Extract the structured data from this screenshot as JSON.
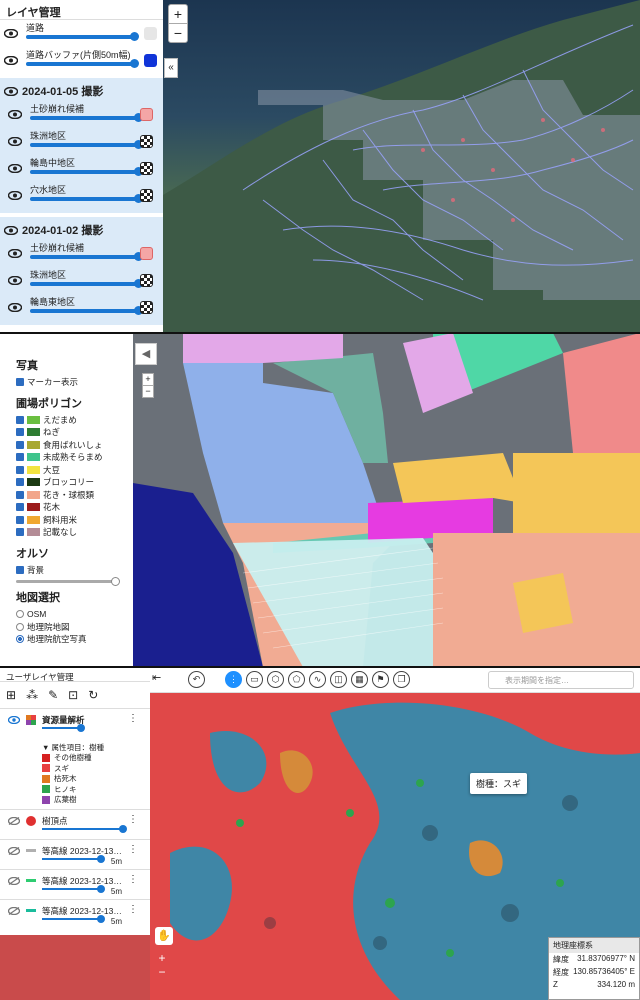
{
  "panel1": {
    "header": "レイヤ管理",
    "top_layers": [
      {
        "label": "道路",
        "swatch": "#e6e6e6"
      },
      {
        "label": "道路バッファ(片側50m幅)",
        "swatch": "#1034d8"
      }
    ],
    "groups": [
      {
        "title": "2024-01-05 撮影",
        "layers": [
          {
            "label": "土砂崩れ候補",
            "swatch": "#f4a6a6"
          },
          {
            "label": "珠洲地区",
            "swatch": "checker"
          },
          {
            "label": "輪島中地区",
            "swatch": "checker"
          },
          {
            "label": "穴水地区",
            "swatch": "checker"
          }
        ]
      },
      {
        "title": "2024-01-02 撮影",
        "layers": [
          {
            "label": "土砂崩れ候補",
            "swatch": "#f4a6a6"
          },
          {
            "label": "珠洲地区",
            "swatch": "checker"
          },
          {
            "label": "輪島東地区",
            "swatch": "checker"
          }
        ]
      }
    ],
    "zoom_in": "+",
    "zoom_out": "−",
    "collapse": "«"
  },
  "panel2": {
    "photo_title": "写真",
    "marker_label": "マーカー表示",
    "polygon_title": "圃場ポリゴン",
    "crops": [
      {
        "label": "えだまめ",
        "color": "#6abf40"
      },
      {
        "label": "ねぎ",
        "color": "#2e7d32"
      },
      {
        "label": "食用ばれいしょ",
        "color": "#a8a832"
      },
      {
        "label": "未成熟そらまめ",
        "color": "#3ec48c"
      },
      {
        "label": "大豆",
        "color": "#f2e440"
      },
      {
        "label": "ブロッコリー",
        "color": "#1b3a12"
      },
      {
        "label": "花き・球根類",
        "color": "#f2a68a"
      },
      {
        "label": "花木",
        "color": "#9c1b1b"
      },
      {
        "label": "飼料用米",
        "color": "#f0a830"
      },
      {
        "label": "記載なし",
        "color": "#b48c96"
      }
    ],
    "ortho_title": "オルソ",
    "background_label": "背景",
    "map_select_title": "地図選択",
    "maps": [
      {
        "label": "OSM",
        "selected": false
      },
      {
        "label": "地理院地図",
        "selected": false
      },
      {
        "label": "地理院航空写真",
        "selected": true
      }
    ],
    "collapse": "◀",
    "zoom_in": "+",
    "zoom_out": "−"
  },
  "panel3": {
    "header": "ユーザレイヤ管理",
    "layer_analysis": "資源量解析",
    "attr_title": "▼ 属性項目：樹種",
    "species": [
      {
        "label": "その他樹種",
        "color": "#d62020"
      },
      {
        "label": "スギ",
        "color": "#e84040"
      },
      {
        "label": "枯死木",
        "color": "#e07820"
      },
      {
        "label": "ヒノキ",
        "color": "#2da44e"
      },
      {
        "label": "広葉樹",
        "color": "#8e44ad"
      }
    ],
    "treetop": "樹頂点",
    "contours": [
      {
        "label": "等高線 2023-12-13…",
        "value": "5m",
        "swatch": "#b0b0b0"
      },
      {
        "label": "等高線 2023-12-13…",
        "value": "5m",
        "swatch": "#2ecc71"
      },
      {
        "label": "等高線 2023-12-13…",
        "value": "5m",
        "swatch": "#1abc9c"
      }
    ],
    "date_placeholder": "表示期間を指定…",
    "tooltip": "樹種：スギ",
    "crs_title": "地理座標系",
    "lat_label": "緯度",
    "lat_value": "31.83706977° N",
    "lon_label": "経度",
    "lon_value": "130.85736405° E",
    "z_label": "Z",
    "z_value": "334.120 m",
    "zoom_in": "+",
    "zoom_out": "−",
    "collapse": "⇤"
  }
}
